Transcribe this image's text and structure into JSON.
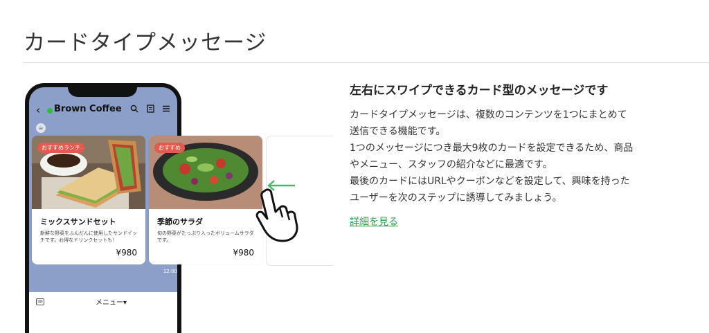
{
  "page": {
    "title": "カードタイプメッセージ"
  },
  "phone": {
    "chat_name": "Brown Coffee",
    "time": "12:00",
    "menu_label": "メニュー▾",
    "icons": [
      "back-icon",
      "search-icon",
      "notes-icon",
      "menu-icon",
      "keyboard-icon"
    ]
  },
  "cards": [
    {
      "badge": "おすすめランチ",
      "title": "ミックスサンドセット",
      "description": "新鮮な野菜をふんだんに使用したサンドイッチです。お得なドリンクセットも！",
      "price": "¥980"
    },
    {
      "badge": "おすすめ",
      "title": "季節のサラダ",
      "description": "旬の野菜がたっぷり入ったボリュームサラダです。",
      "price": "¥980"
    }
  ],
  "feature": {
    "title": "左右にスワイプできるカード型のメッセージです",
    "description": "カードタイプメッセージは、複数のコンテンツを1つにまとめて\n送信できる機能です。\n1つのメッセージにつき最大9枚のカードを設定できるため、商品\nやメニュー、スタッフの紹介などに最適です。\n最後のカードにはURLやクーポンなどを設定して、興味を持った\nユーザーを次のステップに誘導してみましょう。",
    "link_label": "詳細を見る"
  },
  "colors": {
    "accent": "#2da44e",
    "chat_bg": "#8c9fc8",
    "badge": "#e35a4e"
  }
}
